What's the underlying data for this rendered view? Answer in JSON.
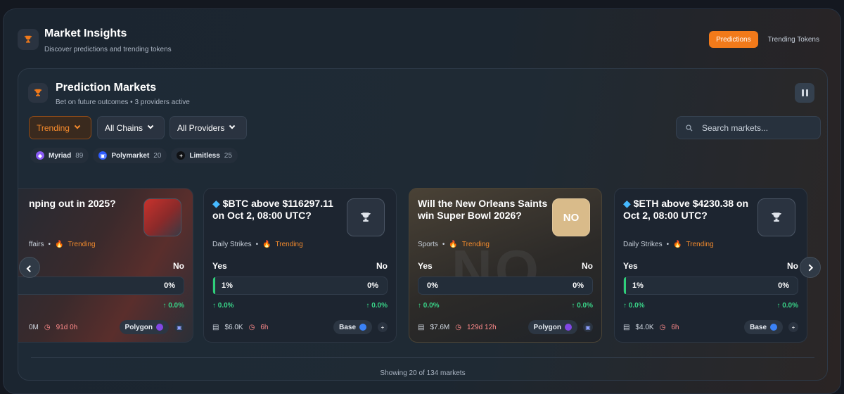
{
  "header": {
    "title": "Market Insights",
    "subtitle": "Discover predictions and trending tokens",
    "tabs": [
      "Predictions",
      "Trending Tokens"
    ],
    "active_tab": "Predictions"
  },
  "panel": {
    "title": "Prediction Markets",
    "subtitle": "Bet on future outcomes • 3 providers active",
    "filters": {
      "sort": "Trending",
      "chains": "All Chains",
      "providers": "All Providers"
    },
    "search_placeholder": "Search markets...",
    "providers": [
      {
        "name": "Myriad",
        "count": "89",
        "color": "#8b5cf6"
      },
      {
        "name": "Polymarket",
        "count": "20",
        "color": "#2e5cff"
      },
      {
        "name": "Limitless",
        "count": "25",
        "color": "#0f1114"
      }
    ],
    "showing": "Showing 20 of 134 markets"
  },
  "cards": [
    {
      "title": "nping out in 2025?",
      "category": "ffairs",
      "trending": "Trending",
      "yes": "",
      "no": "No",
      "yes_pct": "",
      "no_pct": "0%",
      "yes_chg": "",
      "no_chg": "↑ 0.0%",
      "volume": "0M",
      "time": "91d 0h",
      "chain": "Polygon",
      "chain_color": "#8247e5"
    },
    {
      "title": "$BTC above $116297.11 on Oct 2, 08:00 UTC?",
      "category": "Daily Strikes",
      "trending": "Trending",
      "yes": "Yes",
      "no": "No",
      "yes_pct": "1%",
      "no_pct": "0%",
      "yes_chg": "↑ 0.0%",
      "no_chg": "↑ 0.0%",
      "volume": "$6.0K",
      "time": "6h",
      "chain": "Base",
      "chain_color": "#3b82f6"
    },
    {
      "title": "Will the New Orleans Saints win Super Bowl 2026?",
      "category": "Sports",
      "trending": "Trending",
      "yes": "Yes",
      "no": "No",
      "yes_pct": "0%",
      "no_pct": "0%",
      "yes_chg": "↑ 0.0%",
      "no_chg": "↑ 0.0%",
      "volume": "$7.6M",
      "time": "129d 12h",
      "chain": "Polygon",
      "chain_color": "#8247e5",
      "badge": "NO",
      "bg_word": "NO"
    },
    {
      "title": "$ETH above $4230.38 on Oct 2, 08:00 UTC?",
      "category": "Daily Strikes",
      "trending": "Trending",
      "yes": "Yes",
      "no": "No",
      "yes_pct": "1%",
      "no_pct": "0%",
      "yes_chg": "↑ 0.0%",
      "no_chg": "↑ 0.0%",
      "volume": "$4.0K",
      "time": "6h",
      "chain": "Base",
      "chain_color": "#3b82f6"
    }
  ],
  "icons": {
    "trophy": "trophy-icon",
    "pause": "pause-icon",
    "search": "search-icon",
    "diamond": "diamond-icon",
    "fire": "fire-icon",
    "clock": "clock-icon",
    "volume": "stack-icon",
    "prev": "chevron-left-icon",
    "next": "chevron-right-icon"
  },
  "colors": {
    "accent": "#f27a1a",
    "positive": "#39d488",
    "time": "#ff8a8a"
  }
}
